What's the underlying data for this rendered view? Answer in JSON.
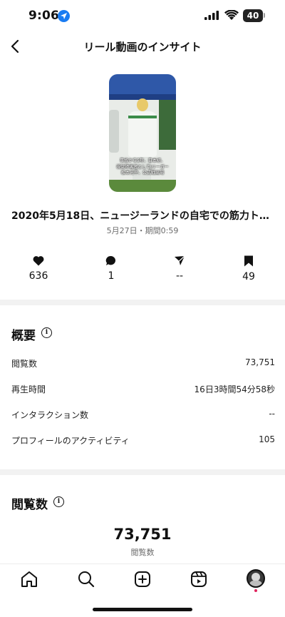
{
  "status_bar": {
    "time": "9:06",
    "battery": "40",
    "icons": [
      "location-arrow-icon",
      "signal-icon",
      "wifi-icon",
      "battery-icon"
    ]
  },
  "header": {
    "title": "リール動画のインサイト",
    "back_icon": "chevron-left-icon"
  },
  "reel": {
    "thumbnail_caption_lines": [
      "事故から5年、日本初、",
      "視覚障害者としてJリーガー",
      "松本光平、公式戦出場"
    ],
    "title": "2020年5月18日、ニュージーランドの自宅での筋力トレーニン…",
    "meta": "5月27日・期間0:59"
  },
  "engagement": [
    {
      "icon": "heart-icon",
      "value": "636"
    },
    {
      "icon": "comment-icon",
      "value": "1"
    },
    {
      "icon": "send-icon",
      "value": "--"
    },
    {
      "icon": "bookmark-icon",
      "value": "49"
    }
  ],
  "overview": {
    "title": "概要",
    "info_icon": "i",
    "rows": [
      {
        "label": "閲覧数",
        "value": "73,751"
      },
      {
        "label": "再生時間",
        "value": "16日3時間54分58秒"
      },
      {
        "label": "インタラクション数",
        "value": "--"
      },
      {
        "label": "プロフィールのアクティビティ",
        "value": "105"
      }
    ]
  },
  "views": {
    "title": "閲覧数",
    "info_icon": "i",
    "total": "73,751",
    "total_label": "閲覧数"
  },
  "tab_bar": {
    "items": [
      "home-icon",
      "search-icon",
      "create-icon",
      "reels-icon",
      "profile-avatar"
    ],
    "active": "profile-avatar"
  },
  "colors": {
    "accent_blue": "#1a7cf2",
    "notification_dot": "#e0245e",
    "divider": "#f2f2f2",
    "muted_text": "#6b6b6b"
  }
}
